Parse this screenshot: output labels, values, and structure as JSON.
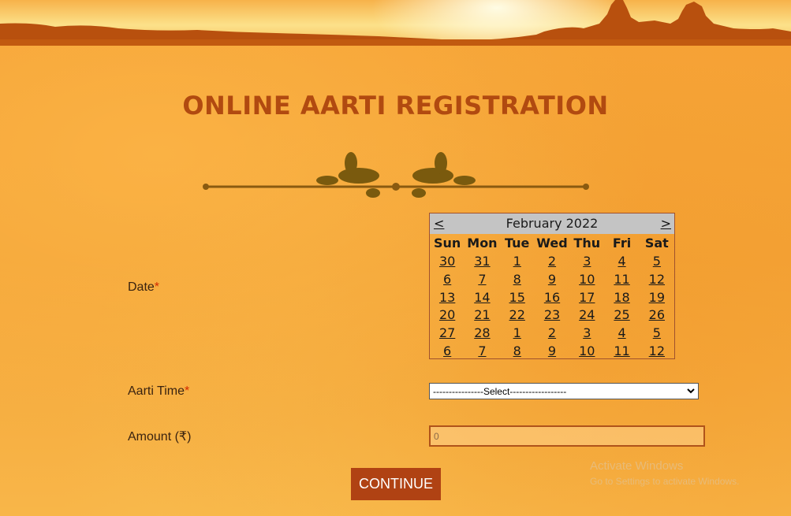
{
  "header": {
    "title": "ONLINE AARTI REGISTRATION"
  },
  "colors": {
    "accent": "#b14a10",
    "button": "#b04213",
    "required": "#d42a00",
    "background": "#f6a235"
  },
  "form": {
    "date_label": "Date",
    "required_mark": "*",
    "time_label": "Aarti Time",
    "amount_label": "Amount (₹)",
    "time_select": {
      "selected": "----------------Select------------------"
    },
    "amount_value": "0",
    "continue_label": "CONTINUE"
  },
  "calendar": {
    "prev": "<",
    "next": ">",
    "month_year": "February 2022",
    "weekdays": [
      "Sun",
      "Mon",
      "Tue",
      "Wed",
      "Thu",
      "Fri",
      "Sat"
    ],
    "days": [
      "30",
      "31",
      "1",
      "2",
      "3",
      "4",
      "5",
      "6",
      "7",
      "8",
      "9",
      "10",
      "11",
      "12",
      "13",
      "14",
      "15",
      "16",
      "17",
      "18",
      "19",
      "20",
      "21",
      "22",
      "23",
      "24",
      "25",
      "26",
      "27",
      "28",
      "1",
      "2",
      "3",
      "4",
      "5",
      "6",
      "7",
      "8",
      "9",
      "10",
      "11",
      "12"
    ]
  },
  "watermark": {
    "line1": "Activate Windows",
    "line2": "Go to Settings to activate Windows."
  },
  "icons": {
    "dropdown": "chevron-down-icon",
    "banner": "temple-silhouette-banner",
    "ornament": "floral-divider-ornament"
  }
}
